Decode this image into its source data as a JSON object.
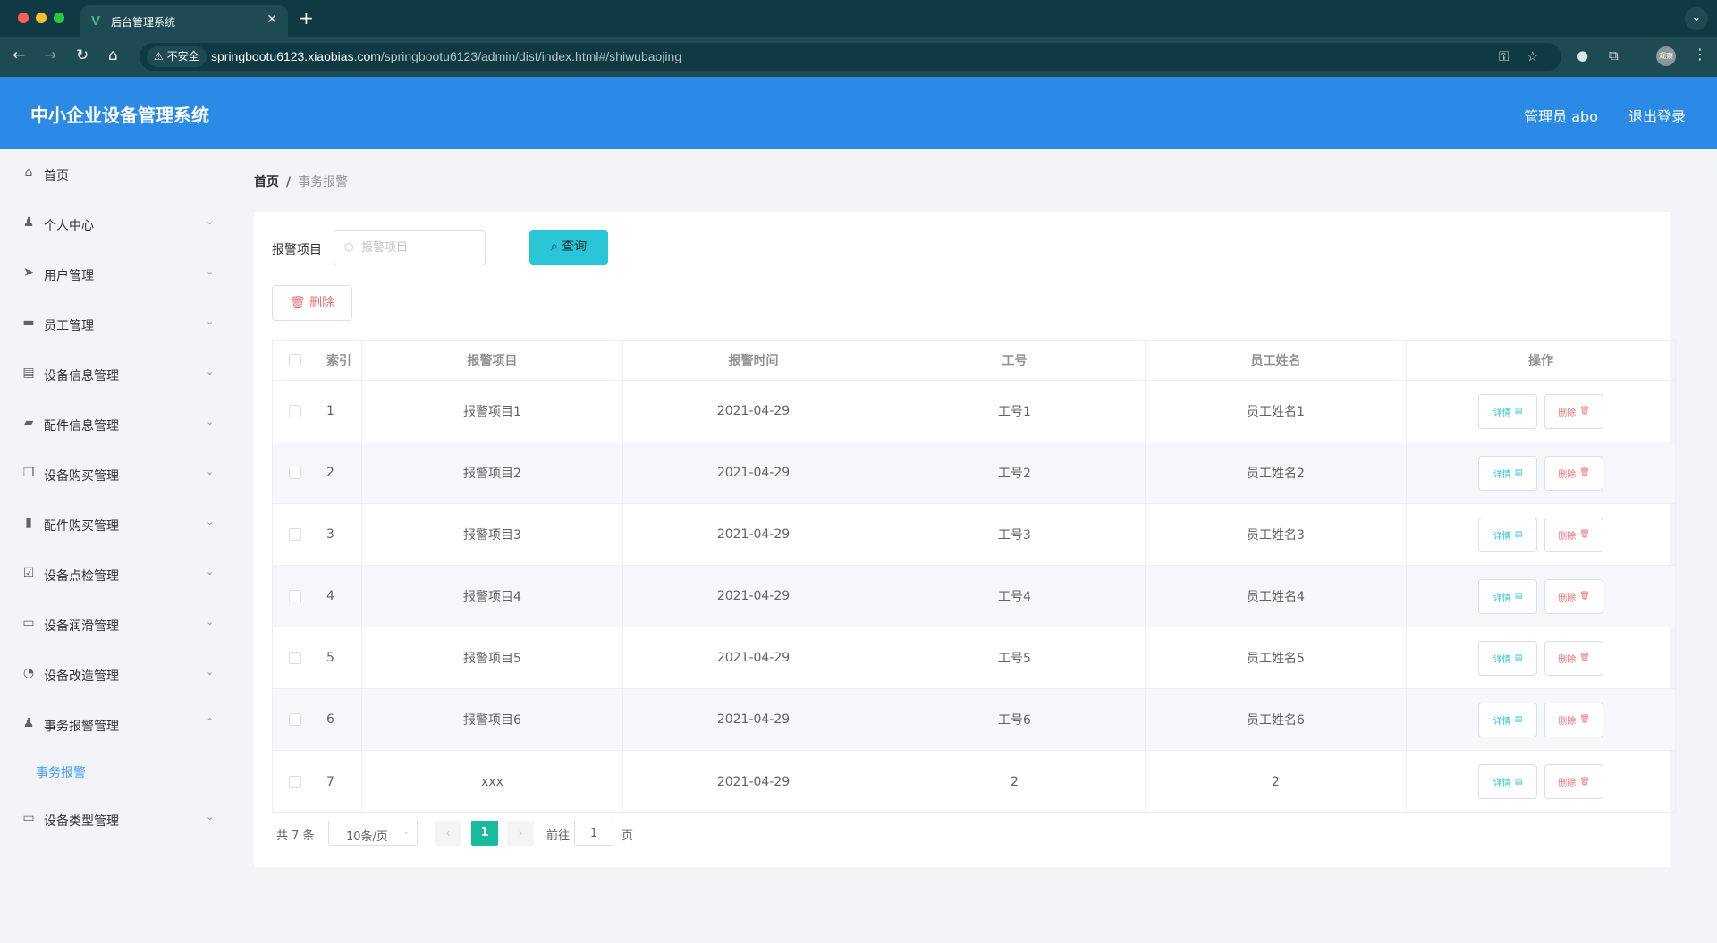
{
  "browser": {
    "tab_title": "后台管理系统",
    "insecure_label": "不安全",
    "url_host": "springbootu6123.xiaobias.com",
    "url_path": "/springbootu6123/admin/dist/index.html#/shiwubaojing",
    "profile_label": "观察"
  },
  "header": {
    "app_title": "中小企业设备管理系统",
    "user_label": "管理员 abo",
    "logout_label": "退出登录"
  },
  "sidebar": {
    "items": [
      {
        "label": "首页",
        "icon": "home-icon"
      },
      {
        "label": "个人中心",
        "icon": "user-icon"
      },
      {
        "label": "用户管理",
        "icon": "send-icon"
      },
      {
        "label": "员工管理",
        "icon": "monitor-icon"
      },
      {
        "label": "设备信息管理",
        "icon": "clipboard-icon"
      },
      {
        "label": "配件信息管理",
        "icon": "box-icon"
      },
      {
        "label": "设备购买管理",
        "icon": "copy-icon"
      },
      {
        "label": "配件购买管理",
        "icon": "bar-chart-icon"
      },
      {
        "label": "设备点检管理",
        "icon": "checklist-icon"
      },
      {
        "label": "设备润滑管理",
        "icon": "chat-icon"
      },
      {
        "label": "设备改造管理",
        "icon": "compass-icon"
      },
      {
        "label": "事务报警管理",
        "icon": "user-icon"
      },
      {
        "label": "设备类型管理",
        "icon": "card-icon"
      }
    ],
    "active_submenu": "事务报警"
  },
  "breadcrumb": {
    "home": "首页",
    "separator": "/",
    "current": "事务报警"
  },
  "search": {
    "label": "报警项目",
    "placeholder": "报警项目",
    "query_button": "查询",
    "delete_button": "删除"
  },
  "table": {
    "headers": [
      "索引",
      "报警项目",
      "报警时间",
      "工号",
      "员工姓名",
      "操作"
    ],
    "detail_label": "详情",
    "delete_label": "删除",
    "rows": [
      {
        "index": "1",
        "item": "报警项目1",
        "time": "2021-04-29",
        "empno": "工号1",
        "name": "员工姓名1"
      },
      {
        "index": "2",
        "item": "报警项目2",
        "time": "2021-04-29",
        "empno": "工号2",
        "name": "员工姓名2"
      },
      {
        "index": "3",
        "item": "报警项目3",
        "time": "2021-04-29",
        "empno": "工号3",
        "name": "员工姓名3"
      },
      {
        "index": "4",
        "item": "报警项目4",
        "time": "2021-04-29",
        "empno": "工号4",
        "name": "员工姓名4"
      },
      {
        "index": "5",
        "item": "报警项目5",
        "time": "2021-04-29",
        "empno": "工号5",
        "name": "员工姓名5"
      },
      {
        "index": "6",
        "item": "报警项目6",
        "time": "2021-04-29",
        "empno": "工号6",
        "name": "员工姓名6"
      },
      {
        "index": "7",
        "item": "xxx",
        "time": "2021-04-29",
        "empno": "2",
        "name": "2"
      }
    ]
  },
  "pagination": {
    "total_text": "共 7 条",
    "page_size": "10条/页",
    "current_page": "1",
    "goto_label": "前往",
    "goto_value": "1",
    "page_suffix": "页"
  },
  "colors": {
    "header_bg": "#2a8ae6",
    "query_button": "#29c6d8",
    "current_page": "#18bc9c",
    "danger": "#f56c6c",
    "active_menu": "#409eff"
  }
}
